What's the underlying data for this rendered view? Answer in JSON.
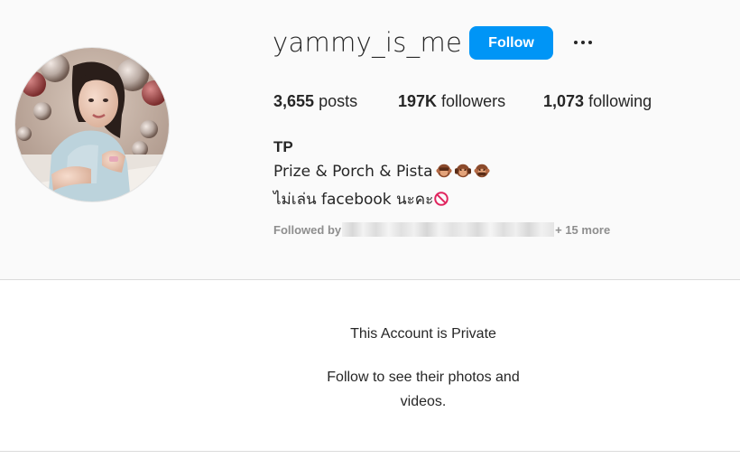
{
  "profile": {
    "username": "yammy_is_me",
    "follow_label": "Follow",
    "more_icon": "more-options-icon",
    "stats": {
      "posts_count": "3,655",
      "posts_label": "posts",
      "followers_count": "197K",
      "followers_label": "followers",
      "following_count": "1,073",
      "following_label": "following"
    },
    "full_name": "TP",
    "bio_line1": "Prize & Porch & Pista",
    "bio_line1_emoji": [
      "see-no-evil-monkey-icon",
      "hear-no-evil-monkey-icon",
      "speak-no-evil-monkey-icon"
    ],
    "bio_line2": "ไม่เล่น facebook นะคะ",
    "bio_line2_emoji": "prohibited-icon",
    "followed_by_prefix": "Followed by",
    "followed_by_suffix": "+ 15 more"
  },
  "private_notice": {
    "title": "This Account is Private",
    "subtitle": "Follow to see their photos and videos."
  },
  "colors": {
    "follow_button": "#0095f6",
    "text": "#262626",
    "muted": "#8e8e8e",
    "header_bg": "#fafafa",
    "divider": "#dbdbdb"
  }
}
